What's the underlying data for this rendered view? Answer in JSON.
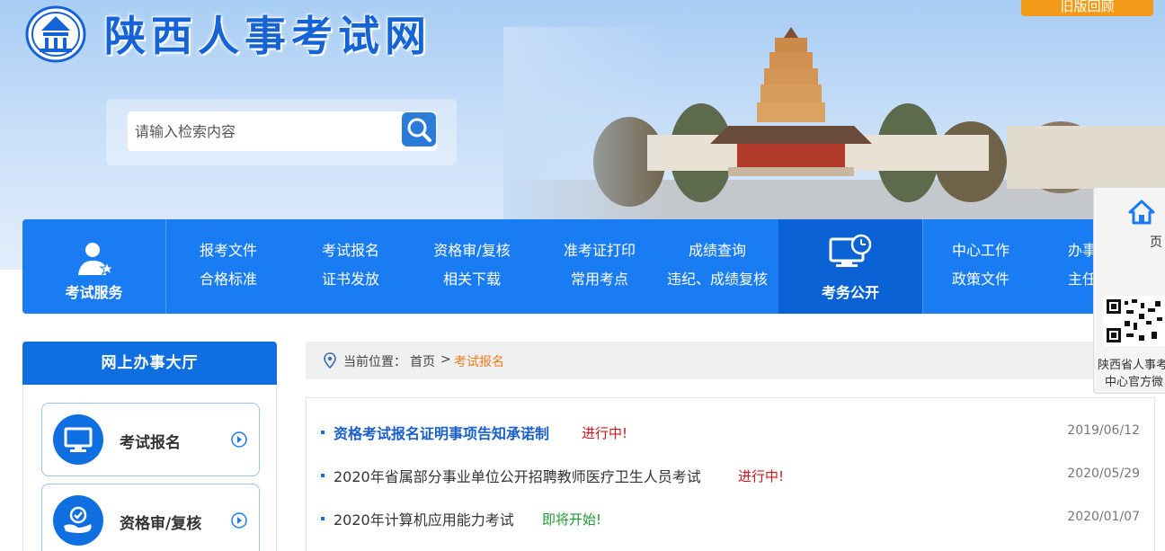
{
  "header": {
    "site_title": "陕西人事考试网",
    "corner_button": "旧版回顾",
    "search": {
      "placeholder": "请输入检索内容"
    }
  },
  "nav": {
    "service_label": "考试服务",
    "public_label": "考务公开",
    "columns": [
      {
        "top": "报考文件",
        "bottom": "合格标准"
      },
      {
        "top": "考试报名",
        "bottom": "证书发放"
      },
      {
        "top": "资格审/复核",
        "bottom": "相关下载"
      },
      {
        "top": "准考证打印",
        "bottom": "常用考点"
      },
      {
        "top": "成绩查询",
        "bottom": "违纪、成绩复核"
      },
      {
        "top": "中心工作",
        "bottom": "政策文件"
      },
      {
        "top": "办事指南",
        "bottom": "主任信箱"
      }
    ]
  },
  "sidebar": {
    "title": "网上办事大厅",
    "items": [
      {
        "label": "考试报名"
      },
      {
        "label": "资格审/复核"
      }
    ]
  },
  "breadcrumb": {
    "prefix": "当前位置：",
    "home": "首页",
    "separator": ">",
    "current": "考试报名"
  },
  "notices": [
    {
      "title": "资格考试报名证明事项告知承诺制",
      "status": "进行中!",
      "date": "2019/06/12"
    },
    {
      "title": "2020年省属部分事业单位公开招聘教师医疗卫生人员考试",
      "status": "进行中!",
      "date": "2020/05/29"
    },
    {
      "title": "2020年计算机应用能力考试",
      "status": "即将开始!",
      "date": "2020/01/07"
    }
  ],
  "float_panel": {
    "page_label": "页",
    "caption_line1": "陕西省人事考",
    "caption_line2": "中心官方微"
  },
  "colors": {
    "brand_blue": "#1a7cf2",
    "dark_blue": "#0a62d4",
    "accent_orange": "#f39b18",
    "status_red": "#d0141a",
    "status_green": "#1d9a2e"
  }
}
